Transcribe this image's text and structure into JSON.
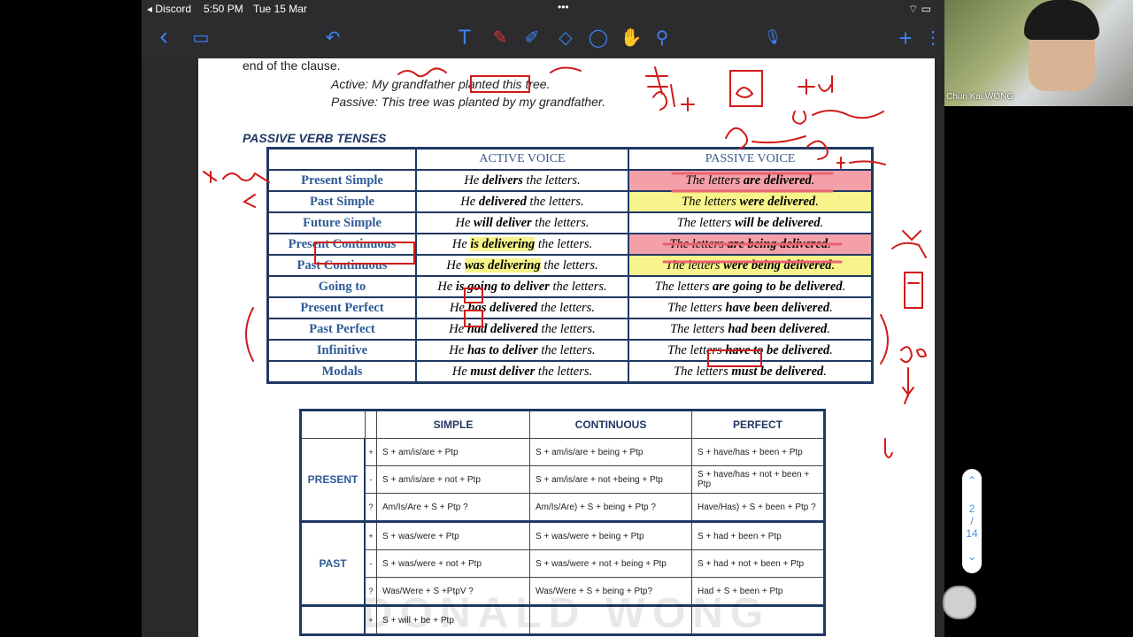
{
  "status_bar": {
    "app": "Discord",
    "time": "5:50 PM",
    "date": "Tue 15 Mar",
    "dots": "•••"
  },
  "toolbar": {
    "back": "‹",
    "pages": "▭",
    "undo": "↶",
    "text": "T",
    "pen": "✎",
    "highlighter": "✐",
    "eraser": "◇",
    "lasso": "◯",
    "shapes": "✋",
    "zoom": "⚲",
    "mic": "🎙",
    "add": "+",
    "more": "⋮"
  },
  "document": {
    "intro_tail": "end of the clause.",
    "active_example": "Active: My grandfather planted this tree.",
    "passive_example": "Passive: This tree was planted by my grandfather.",
    "section_title": "PASSIVE VERB TENSES",
    "passive_table": {
      "headers": [
        "",
        "ACTIVE VOICE",
        "PASSIVE VOICE"
      ],
      "rows": [
        {
          "tense": "Present Simple",
          "active_pre": "He ",
          "active_b": "delivers",
          "active_post": " the letters.",
          "passive_pre": "The letters ",
          "passive_b": "are delivered",
          "passive_post": "."
        },
        {
          "tense": "Past Simple",
          "active_pre": "He ",
          "active_b": "delivered",
          "active_post": " the letters.",
          "passive_pre": "The letters ",
          "passive_b": "were delivered",
          "passive_post": "."
        },
        {
          "tense": "Future Simple",
          "active_pre": "He ",
          "active_b": "will deliver",
          "active_post": " the letters.",
          "passive_pre": "The letters ",
          "passive_b": "will be delivered",
          "passive_post": "."
        },
        {
          "tense": "Present Continuous",
          "active_pre": "He ",
          "active_b": "is delivering",
          "active_post": " the letters.",
          "passive_pre": "The letters ",
          "passive_b": "are being delivered",
          "passive_post": "."
        },
        {
          "tense": "Past Continuous",
          "active_pre": "He ",
          "active_b": "was delivering",
          "active_post": " the letters.",
          "passive_pre": "The letters ",
          "passive_b": "were being delivered",
          "passive_post": "."
        },
        {
          "tense": "Going to",
          "active_pre": "He ",
          "active_b": "is going to deliver",
          "active_post": " the letters.",
          "passive_pre": "The letters ",
          "passive_b": "are going to be delivered",
          "passive_post": "."
        },
        {
          "tense": "Present Perfect",
          "active_pre": "He ",
          "active_b": "has delivered",
          "active_post": " the letters.",
          "passive_pre": "The letters ",
          "passive_b": "have been delivered",
          "passive_post": "."
        },
        {
          "tense": "Past Perfect",
          "active_pre": "He ",
          "active_b": "had delivered",
          "active_post": " the letters.",
          "passive_pre": "The letters ",
          "passive_b": "had been delivered",
          "passive_post": "."
        },
        {
          "tense": "Infinitive",
          "active_pre": "He ",
          "active_b": "has to deliver",
          "active_post": " the letters.",
          "passive_pre": "The letters ",
          "passive_b": "have to be delivered",
          "passive_post": "."
        },
        {
          "tense": "Modals",
          "active_pre": "He ",
          "active_b": "must deliver",
          "active_post": " the letters.",
          "passive_pre": "The letters ",
          "passive_b": "must be delivered",
          "passive_post": "."
        }
      ]
    },
    "form_table": {
      "headers": [
        "",
        "",
        "SIMPLE",
        "CONTINUOUS",
        "PERFECT"
      ],
      "groups": [
        {
          "name": "PRESENT",
          "rows": [
            {
              "sym": "+",
              "simple": "S + am/is/are + Ptp",
              "cont": "S + am/is/are + being + Ptp",
              "perf": "S + have/has + been + Ptp"
            },
            {
              "sym": "-",
              "simple": "S + am/is/are +  not + Ptp",
              "cont": "S + am/is/are + not +being + Ptp",
              "perf": "S + have/has + not + been + Ptp"
            },
            {
              "sym": "?",
              "simple": "Am/Is/Are + S + Ptp ?",
              "cont": "Am/Is/Are) + S + being + Ptp ?",
              "perf": "Have/Has) + S + been + Ptp ?"
            }
          ]
        },
        {
          "name": "PAST",
          "rows": [
            {
              "sym": "+",
              "simple": "S + was/were + Ptp",
              "cont": "S + was/were + being + Ptp",
              "perf": "S + had + been + Ptp"
            },
            {
              "sym": "-",
              "simple": "S + was/were + not + Ptp",
              "cont": "S + was/were + not + being + Ptp",
              "perf": "S + had + not + been +  Ptp"
            },
            {
              "sym": "?",
              "simple": "Was/Were + S +PtpV ?",
              "cont": "Was/Were + S + being + Ptp?",
              "perf": "Had + S + been + Ptp"
            }
          ]
        },
        {
          "name": "",
          "rows": [
            {
              "sym": "+",
              "simple": "S + will + be + Ptp",
              "cont": "",
              "perf": ""
            }
          ]
        }
      ]
    },
    "watermark": "DONALD WONG"
  },
  "pager": {
    "up": "⌃",
    "current": "2",
    "sep": "/",
    "total": "14",
    "down": "⌄"
  },
  "video": {
    "name": "Chun Kai WONG"
  },
  "colors": {
    "ink_red": "#d11a1a",
    "toolbar_accent": "#3b82f6",
    "table_border": "#1f3864",
    "tense_text": "#2e5b96"
  }
}
